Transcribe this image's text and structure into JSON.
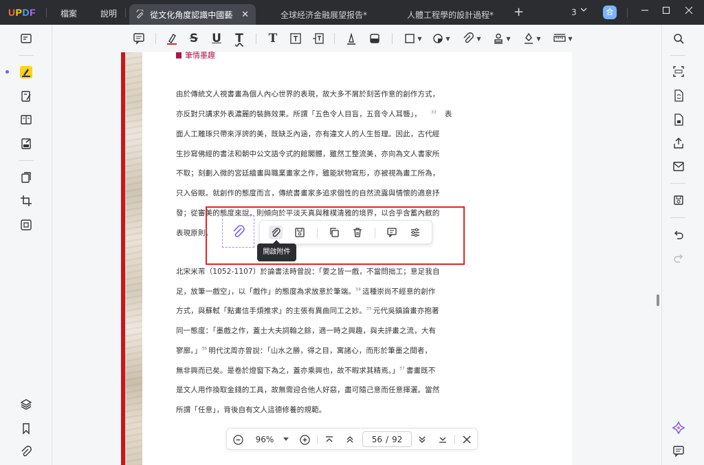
{
  "app": {
    "logo": {
      "u": "U",
      "p": "P",
      "d": "D",
      "f": "F"
    },
    "menu": {
      "file": "檔案",
      "help": "說明"
    },
    "tabs": [
      {
        "label": "從文化角度認識中國藝術*",
        "active": true
      },
      {
        "label": "全球经济金融展望报告*",
        "active": false
      },
      {
        "label": "人體工程學的設計過程*",
        "active": false
      }
    ],
    "window_count": "3",
    "avatar_letter": "合"
  },
  "toolbar": {
    "icons": [
      "comment-icon",
      "highlight-icon",
      "strikethrough-icon",
      "underline-icon",
      "squiggly-icon",
      "text-icon",
      "textbox-icon",
      "text-callout-icon",
      "pencil-icon",
      "eraser-icon",
      "shape-icon",
      "sticker-icon",
      "attachment-icon",
      "stamp-icon",
      "signature-icon",
      "measure-icon"
    ],
    "labels": {
      "strike": "S",
      "underline": "U",
      "squiggly": "T",
      "text": "T"
    }
  },
  "document": {
    "section_title": "筆情墨趣",
    "lines": [
      "由於傳統文人視書畫為個人內心世界的表現，故大多不屑於刻苦作意的創作方式，",
      "亦反對只講求外表濃麗的裝飾效果。所謂「五色令人目盲，五音令人耳聾」，",
      "面人工雕琢只帶來浮誇的美，既缺乏內涵，亦有違文人的人生哲理。因此，古代經",
      "生抄寫佛經的書法和朝中公文語令式的館閣體，雖然工整流美，亦向為文人書家所",
      "不取；刻劃入微的宮廷繪畫與職業畫家之作，雖能狀物寫形，亦被視為畫工所為，",
      "只入俗眼。就創作的態度而言，傳統書畫家多追求個性的自然流露與情懷的適意抒",
      "發；從審美的態度來說，則傾向於平淡天真與稚樸清雅的境界，以合乎含蓄內斂的",
      "表現原則。",
      "北宋米芾（1052-1107）於論書法時曾說：「要之皆一戲，不當問拙工；意足我自",
      "足，放筆一戲空」，以「戲作」的態度為求放意於筆端。",
      "方式，與蘇軾「點畫信手煩推求」的主張有異曲同工之妙。",
      "同一態度：「墨戲之作，蓋士大夫詞翰之餘，適一時之興趣，與夫評畫之流，大有",
      "寥廓。」",
      "無非興而已矣。是卷於燈窗下為之，蓋亦乘興也，故不暇求其精焉。」",
      "是文人用作換取金錢的工具，故無需迎合他人好惡，盡可隨己意而任意揮灑。當然",
      "所謂「任意」，背後自有文人這德修養的規範。"
    ],
    "line_extras": {
      "l1_sup": "33",
      "l1_tail": "表",
      "l9_sup": "34",
      "l9_tail": "這種崇尚不經意的創作",
      "l10_sup": "35",
      "l10_tail": "元代吳鎮論畫亦抱著",
      "l12_sup": "36",
      "l12_tail": "明代沈周亦曾說：「山水之勝，得之目，寓諸心，而形於筆墨之間者，",
      "l13_sup": "37",
      "l13_tail": "書畫既不"
    }
  },
  "floating_toolbar": {
    "buttons": [
      "open-attachment-icon",
      "save-icon",
      "copy-icon",
      "delete-icon",
      "comment-icon",
      "properties-icon"
    ],
    "tooltip": "開啟附件"
  },
  "navigation": {
    "zoom": "96%",
    "current_page": "56",
    "separator": "/",
    "total_pages": "92"
  }
}
